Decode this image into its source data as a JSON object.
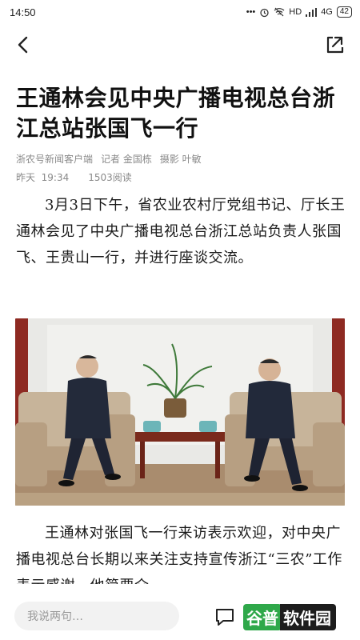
{
  "status_bar": {
    "time": "14:50",
    "signal_text": "HD",
    "network": "4G",
    "battery": "42"
  },
  "nav": {
    "back_icon": "chevron-left-icon",
    "share_icon": "share-icon"
  },
  "article": {
    "title": "王通林会见中央广播电视总台浙江总站张国飞一行",
    "source": "浙农号新闻客户端",
    "reporter": "记者  金国栋",
    "photographer": "摄影  叶敏",
    "date": "昨天",
    "time": "19:34",
    "reads": "1503阅读",
    "paragraph1": "3月3日下午，省农业农村厅党组书记、厅长王通林会见了中央广播电视总台浙江总站负责人张国飞、王贵山一行，并进行座谈交流。",
    "paragraph2": "王通林对张国飞一行来访表示欢迎，对中央广播电视总台长期以来关注支持宣传浙江“三农”工作表示感谢。他简要介"
  },
  "bottom_bar": {
    "comment_placeholder": "我说两句…",
    "watermark_a": "谷普",
    "watermark_b": "软件园"
  },
  "colors": {
    "meta_gray": "#8a8a8a",
    "watermark_green": "#2fa84a"
  }
}
